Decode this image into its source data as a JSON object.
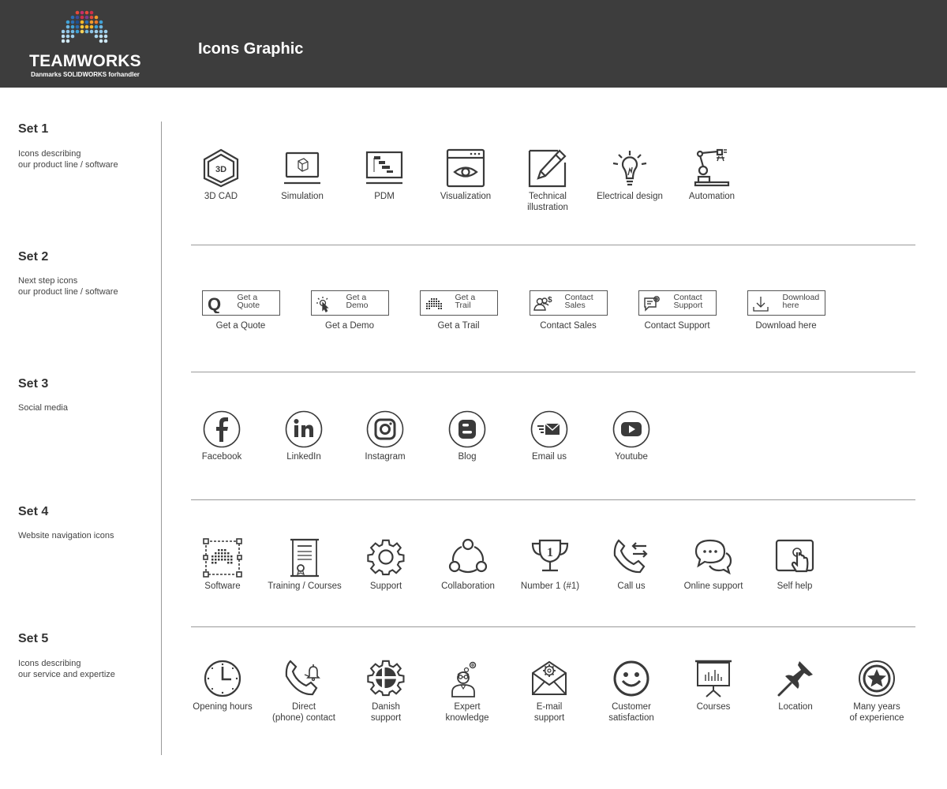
{
  "header": {
    "logo_word": "TEAMWORKS",
    "logo_sub": "Danmarks SOLIDWORKS forhandler",
    "title": "Icons Graphic",
    "background": "#3d3d3d"
  },
  "sets": [
    {
      "title": "Set 1",
      "description": "Icons describing\nour product line / software",
      "items": [
        {
          "icon": "3d-cad-icon",
          "label": "3D CAD"
        },
        {
          "icon": "simulation-icon",
          "label": "Simulation"
        },
        {
          "icon": "pdm-icon",
          "label": "PDM"
        },
        {
          "icon": "visualization-icon",
          "label": "Visualization"
        },
        {
          "icon": "technical-illustration-icon",
          "label": "Technical\nillustration"
        },
        {
          "icon": "electrical-design-icon",
          "label": "Electrical design"
        },
        {
          "icon": "automation-icon",
          "label": "Automation"
        }
      ]
    },
    {
      "title": "Set 2",
      "description": "Next step icons\nour product line / software",
      "buttons": [
        {
          "icon": "quote-icon",
          "button_text": "Get a\nQuote",
          "label": "Get a Quote"
        },
        {
          "icon": "demo-icon",
          "button_text": "Get a\nDemo",
          "label": "Get a Demo"
        },
        {
          "icon": "trail-icon",
          "button_text": "Get a\nTrail",
          "label": "Get a Trail"
        },
        {
          "icon": "contact-sales-icon",
          "button_text": "Contact\nSales",
          "label": "Contact Sales"
        },
        {
          "icon": "contact-support-icon",
          "button_text": "Contact\nSupport",
          "label": "Contact Support"
        },
        {
          "icon": "download-icon",
          "button_text": "Download\nhere",
          "label": "Download here"
        }
      ]
    },
    {
      "title": "Set 3",
      "description": "Social media",
      "items": [
        {
          "icon": "facebook-icon",
          "label": "Facebook"
        },
        {
          "icon": "linkedin-icon",
          "label": "LinkedIn"
        },
        {
          "icon": "instagram-icon",
          "label": "Instagram"
        },
        {
          "icon": "blog-icon",
          "label": "Blog"
        },
        {
          "icon": "email-icon",
          "label": "Email us"
        },
        {
          "icon": "youtube-icon",
          "label": "Youtube"
        }
      ]
    },
    {
      "title": "Set 4",
      "description": "Website navigation icons",
      "items": [
        {
          "icon": "software-icon",
          "label": "Software"
        },
        {
          "icon": "training-certificate-icon",
          "label": "Training / Courses"
        },
        {
          "icon": "support-gear-icon",
          "label": "Support"
        },
        {
          "icon": "collaboration-icon",
          "label": "Collaboration"
        },
        {
          "icon": "trophy-icon",
          "label": "Number 1 (#1)"
        },
        {
          "icon": "call-icon",
          "label": "Call us"
        },
        {
          "icon": "chat-bubbles-icon",
          "label": "Online support"
        },
        {
          "icon": "self-help-touch-icon",
          "label": "Self help"
        }
      ]
    },
    {
      "title": "Set 5",
      "description": "Icons describing\nour service and expertize",
      "items": [
        {
          "icon": "clock-icon",
          "label": "Opening hours"
        },
        {
          "icon": "phone-bell-icon",
          "label": "Direct\n(phone) contact"
        },
        {
          "icon": "danish-gear-icon",
          "label": "Danish\nsupport"
        },
        {
          "icon": "expert-icon",
          "label": "Expert\nknowledge"
        },
        {
          "icon": "email-gear-icon",
          "label": "E-mail\nsupport"
        },
        {
          "icon": "smiley-icon",
          "label": "Customer\nsatisfaction"
        },
        {
          "icon": "presentation-icon",
          "label": "Courses"
        },
        {
          "icon": "pushpin-icon",
          "label": "Location"
        },
        {
          "icon": "star-badge-icon",
          "label": "Many years\nof experience"
        }
      ]
    }
  ]
}
